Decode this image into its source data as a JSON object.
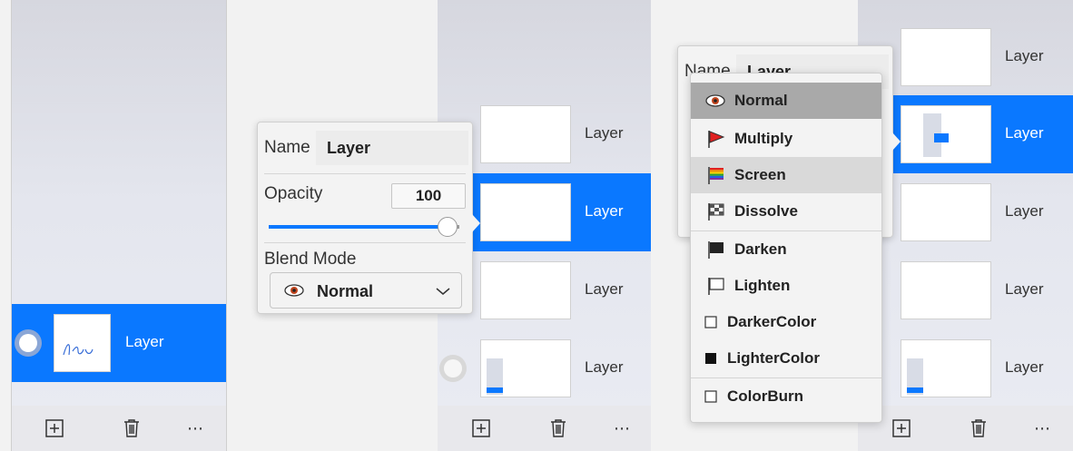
{
  "panel1": {
    "layer": {
      "label": "Layer"
    },
    "toolbar": {
      "add": "add-layer",
      "delete": "delete-layer",
      "more": "⋯"
    }
  },
  "panel2": {
    "properties": {
      "name_label": "Name",
      "name_value": "Layer",
      "opacity_label": "Opacity",
      "opacity_value": "100",
      "opacity_level": 1.0,
      "blend_label": "Blend Mode",
      "blend_value": "Normal"
    },
    "layers": [
      "Layer",
      "Layer",
      "Layer",
      "Layer"
    ],
    "toolbar": {
      "more": "⋯"
    }
  },
  "panel3": {
    "properties_partial": {
      "name_label": "Name",
      "name_value": "Layer"
    },
    "blend_menu": [
      "Normal",
      "Multiply",
      "Screen",
      "Dissolve",
      "Darken",
      "Lighten",
      "DarkerColor",
      "LighterColor",
      "ColorBurn"
    ],
    "layers": [
      "Layer",
      "Layer",
      "Layer",
      "Layer",
      "Layer"
    ],
    "toolbar": {
      "more": "⋯"
    }
  },
  "colors": {
    "accent": "#0a78ff",
    "panel_bg": "#e4e6ee",
    "popover_bg": "#f3f3f3"
  }
}
